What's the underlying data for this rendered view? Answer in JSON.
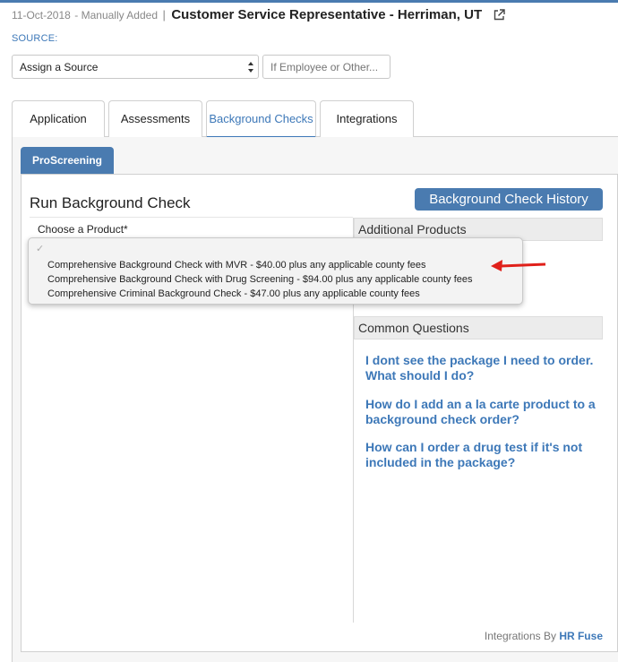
{
  "header": {
    "date": "11-Oct-2018",
    "added_by": "Manually Added",
    "separator": "|",
    "job_title": "Customer Service Representative - Herriman, UT",
    "external_link_icon": "external-link-icon"
  },
  "source": {
    "label": "SOURCE:",
    "select_value": "Assign a Source",
    "other_placeholder": "If Employee or Other..."
  },
  "tabs": [
    {
      "label": "Application",
      "active": false
    },
    {
      "label": "Assessments",
      "active": false
    },
    {
      "label": "Background Checks",
      "active": true
    },
    {
      "label": "Integrations",
      "active": false
    }
  ],
  "subtab": {
    "label": "ProScreening"
  },
  "run_check": {
    "title": "Run Background Check",
    "history_button": "Background Check History",
    "choose_label": "Choose a Product*"
  },
  "dropdown": {
    "check_mark": "✓",
    "options": [
      "Comprehensive Background Check with MVR - $40.00 plus any applicable county fees",
      "Comprehensive Background Check with Drug Screening - $94.00 plus any applicable county fees",
      "Comprehensive Criminal Background Check - $47.00 plus any applicable county fees"
    ]
  },
  "additional_products": {
    "title": "Additional Products"
  },
  "common_questions": {
    "title": "Common Questions",
    "items": [
      "I dont see the package I need to order. What should I do?",
      "How do I add an a la carte product to a background check order?",
      "How can I order a drug test if it's not included in the package?"
    ]
  },
  "footer": {
    "text": "Integrations By",
    "brand": "HR Fuse"
  },
  "colors": {
    "accent": "#4a7bb0",
    "link": "#3d78b8",
    "annotation_arrow": "#e0201a"
  }
}
